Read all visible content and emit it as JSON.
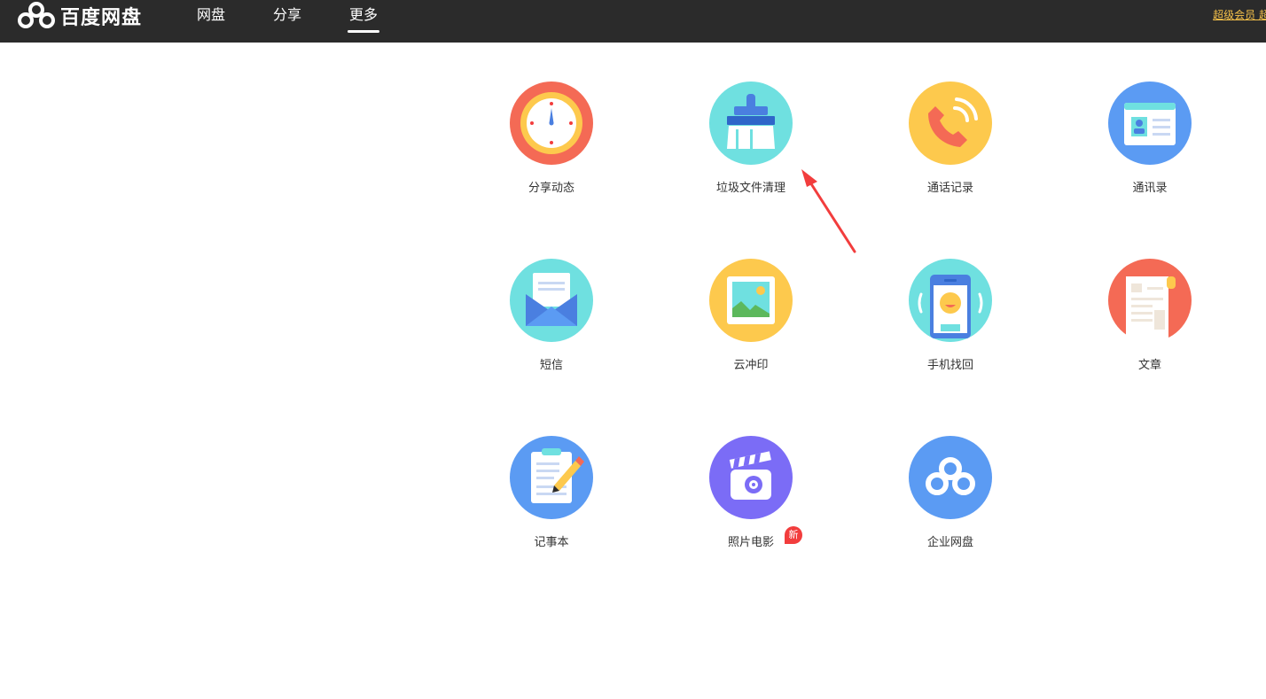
{
  "app": {
    "logo_text": "百度网盘"
  },
  "nav": {
    "tabs": [
      {
        "label": "网盘",
        "active": false
      },
      {
        "label": "分享",
        "active": false
      },
      {
        "label": "更多",
        "active": true
      }
    ],
    "vip_link": "超级会员 超"
  },
  "colors": {
    "topbar": "#2b2b2b",
    "label_text": "#333333",
    "annotation_arrow": "#f23d3d",
    "badge": "#f23d3d",
    "vip_link": "#f5c14a"
  },
  "apps": [
    {
      "label": "分享动态",
      "icon": "clock-icon",
      "color": "#f46a55"
    },
    {
      "label": "垃圾文件清理",
      "icon": "broom-icon",
      "color": "#6fe0e0"
    },
    {
      "label": "通话记录",
      "icon": "phone-call-icon",
      "color": "#fdc94d"
    },
    {
      "label": "通讯录",
      "icon": "contact-card-icon",
      "color": "#5b9bf3"
    },
    {
      "label": "短信",
      "icon": "envelope-icon",
      "color": "#6fe0e0"
    },
    {
      "label": "云冲印",
      "icon": "picture-icon",
      "color": "#fdc94d"
    },
    {
      "label": "手机找回",
      "icon": "phone-finder-icon",
      "color": "#6fe0e0"
    },
    {
      "label": "文章",
      "icon": "document-icon",
      "color": "#f46a55"
    },
    {
      "label": "记事本",
      "icon": "notepad-icon",
      "color": "#5b9bf3"
    },
    {
      "label": "照片电影",
      "icon": "clapperboard-icon",
      "color": "#7b6cf6",
      "badge": "新"
    },
    {
      "label": "企业网盘",
      "icon": "cloud-logo-icon",
      "color": "#5b9bf3"
    }
  ]
}
